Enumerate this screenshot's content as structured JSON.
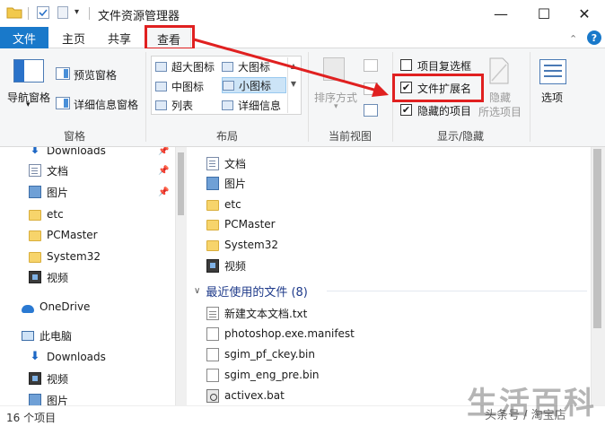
{
  "window": {
    "title": "文件资源管理器",
    "minimize": "—",
    "maximize": "☐",
    "close": "✕"
  },
  "quick_access": {
    "dropdown": "▾"
  },
  "tabs": {
    "file": "文件",
    "home": "主页",
    "share": "共享",
    "view": "查看",
    "pin": "⌃",
    "help": "?"
  },
  "ribbon": {
    "panes": {
      "label": "窗格",
      "navigation_pane": "导航窗格",
      "navigation_pane_arrow": "▾",
      "preview_pane": "预览窗格",
      "details_pane": "详细信息窗格"
    },
    "layout": {
      "label": "布局",
      "items": [
        "超大图标",
        "大图标",
        "中图标",
        "小图标",
        "列表",
        "详细信息"
      ],
      "selected": "小图标",
      "scroll_up": "▲",
      "scroll_down": "▼"
    },
    "current_view": {
      "label": "当前视图",
      "sort_by": "排序方式",
      "sort_arrow": "▾"
    },
    "show_hide": {
      "label": "显示/隐藏",
      "item_checkboxes": {
        "label": "项目复选框",
        "checked": false
      },
      "file_extensions": {
        "label": "文件扩展名",
        "checked": true
      },
      "hidden_items": {
        "label": "隐藏的项目",
        "checked": true
      },
      "hide": "隐藏",
      "hide_selected": "所选项目",
      "check": "✔"
    },
    "options": {
      "label": "选项"
    }
  },
  "nav_pane": {
    "items": [
      {
        "label": "Downloads",
        "icon": "download-icon",
        "pinned": true
      },
      {
        "label": "文档",
        "icon": "document-icon",
        "pinned": true
      },
      {
        "label": "图片",
        "icon": "picture-icon",
        "pinned": true
      },
      {
        "label": "etc",
        "icon": "folder-icon",
        "pinned": false
      },
      {
        "label": "PCMaster",
        "icon": "folder-icon",
        "pinned": false
      },
      {
        "label": "System32",
        "icon": "folder-icon",
        "pinned": false
      },
      {
        "label": "视频",
        "icon": "video-icon",
        "pinned": false
      },
      {
        "label": "OneDrive",
        "icon": "cloud-icon",
        "pinned": false
      },
      {
        "label": "此电脑",
        "icon": "computer-icon",
        "pinned": false
      },
      {
        "label": "Downloads",
        "icon": "download-icon",
        "pinned": false
      },
      {
        "label": "视频",
        "icon": "video-icon",
        "pinned": false
      },
      {
        "label": "图片",
        "icon": "picture-icon",
        "pinned": false
      }
    ],
    "pin_glyph": "📌"
  },
  "content": {
    "frequent": [
      {
        "label": "文档",
        "icon": "document-icon"
      },
      {
        "label": "图片",
        "icon": "picture-icon"
      },
      {
        "label": "etc",
        "icon": "folder-icon"
      },
      {
        "label": "PCMaster",
        "icon": "folder-icon"
      },
      {
        "label": "System32",
        "icon": "folder-icon"
      },
      {
        "label": "视频",
        "icon": "video-icon"
      }
    ],
    "recent_header": "最近使用的文件 (8)",
    "recent_chevron": "∨",
    "recent": [
      {
        "label": "新建文本文档.txt",
        "icon": "text-file-icon"
      },
      {
        "label": "photoshop.exe.manifest",
        "icon": "file-icon"
      },
      {
        "label": "sgim_pf_ckey.bin",
        "icon": "file-icon"
      },
      {
        "label": "sgim_eng_pre.bin",
        "icon": "file-icon"
      },
      {
        "label": "activex.bat",
        "icon": "batch-file-icon"
      }
    ]
  },
  "status": {
    "item_count": "16 个项目"
  },
  "watermark": {
    "brand": "生活百科",
    "account": "头条号 / 淘宝店"
  },
  "colors": {
    "accent": "#1979ca",
    "annotation": "#e02020",
    "folder": "#f7d46b",
    "header_link": "#1e3a8a"
  }
}
